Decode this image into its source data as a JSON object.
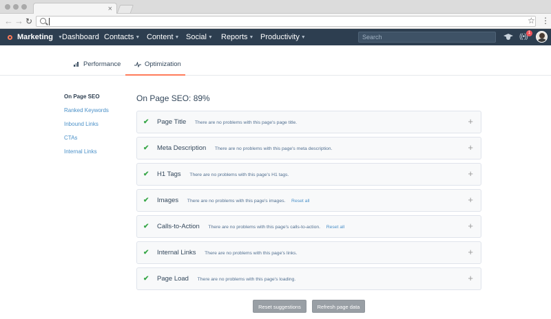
{
  "browser": {
    "tab_close": "×",
    "star": "☆",
    "menu": "⋮",
    "icons": [
      "back-icon",
      "forward-icon",
      "reload-icon",
      "search-icon",
      "star-icon",
      "more-vert-icon"
    ]
  },
  "nav": {
    "brand": "Marketing",
    "items": [
      {
        "label": "Dashboard"
      },
      {
        "label": "Contacts"
      },
      {
        "label": "Content"
      },
      {
        "label": "Social"
      },
      {
        "label": "Reports"
      },
      {
        "label": "Productivity"
      }
    ],
    "search_placeholder": "Search",
    "notification_count": "1",
    "accent_color": "#ff7a59",
    "nav_bg": "#2d3e50"
  },
  "tabs": [
    {
      "label": "Performance",
      "icon": "bar-chart-icon"
    },
    {
      "label": "Optimization",
      "icon": "pulse-icon",
      "active": true
    }
  ],
  "sidebar": [
    {
      "label": "On Page SEO",
      "active": true
    },
    {
      "label": "Ranked Keywords"
    },
    {
      "label": "Inbound Links"
    },
    {
      "label": "CTAs"
    },
    {
      "label": "Internal Links"
    }
  ],
  "main": {
    "title": "On Page SEO: 89%",
    "cards": [
      {
        "name": "Page Title",
        "message": "There are no problems with this page's page title.",
        "action": ""
      },
      {
        "name": "Meta Description",
        "message": "There are no problems with this page's meta description.",
        "action": ""
      },
      {
        "name": "H1 Tags",
        "message": "There are no problems with this page's H1 tags.",
        "action": ""
      },
      {
        "name": "Images",
        "message": "There are no problems with this page's images.",
        "action": "Reset all"
      },
      {
        "name": "Calls-to-Action",
        "message": "There are no problems with this page's calls-to-action.",
        "action": "Reset all"
      },
      {
        "name": "Internal Links",
        "message": "There are no problems with this page's links.",
        "action": ""
      },
      {
        "name": "Page Load",
        "message": "There are no problems with this page's loading.",
        "action": ""
      }
    ],
    "check_glyph": "✔",
    "plus_glyph": "+",
    "reset_suggestions": "Reset suggestions",
    "refresh_page_data": "Refresh page data"
  }
}
